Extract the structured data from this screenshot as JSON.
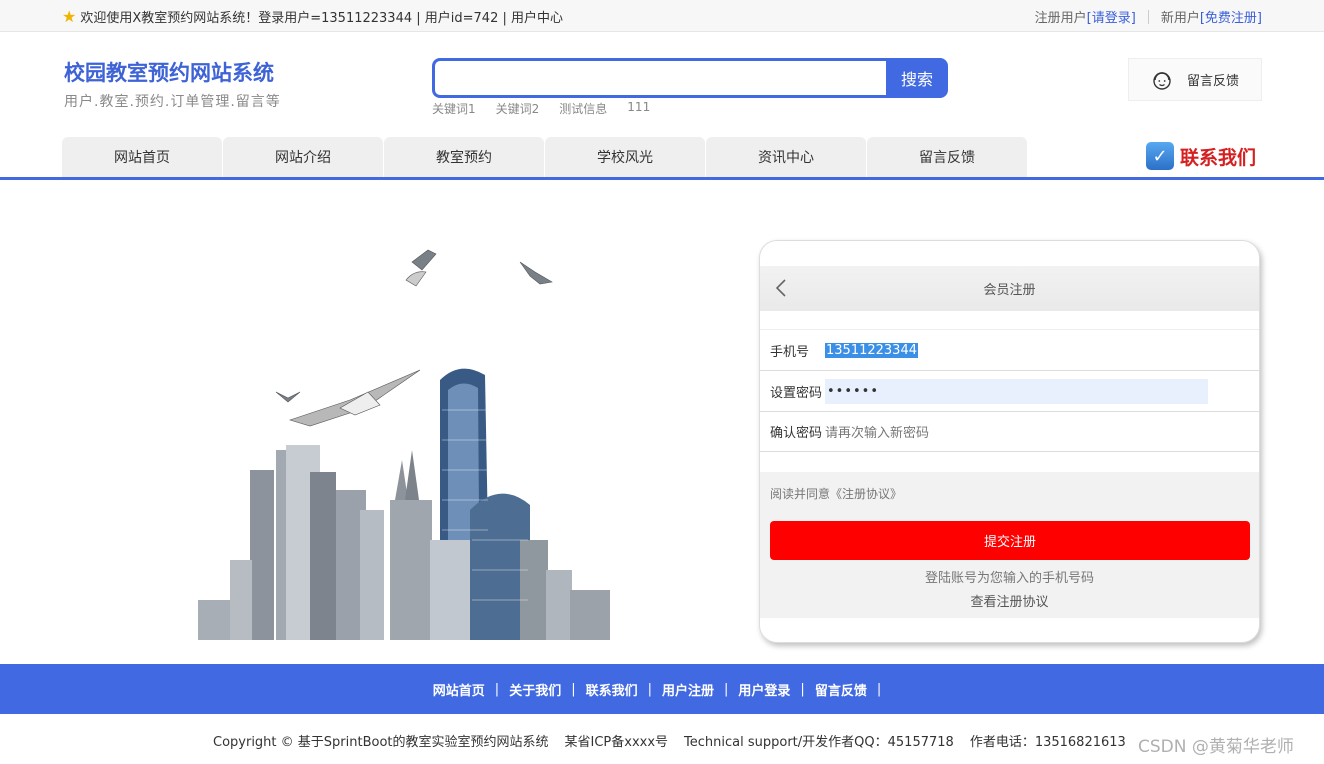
{
  "topbar": {
    "welcome": "欢迎使用X教室预约网站系统！登录用户=13511223344 | 用户id=742 | 用户中心",
    "registered_user": "注册用户",
    "login_link": "[请登录]",
    "new_user": "新用户",
    "register_link": "[免费注册]"
  },
  "brand": {
    "title": "校园教室预约网站系统",
    "subtitle": "用户.教室.预约.订单管理.留言等"
  },
  "search": {
    "button": "搜索",
    "keywords": [
      "关键词1",
      "关键词2",
      "测试信息",
      "111"
    ]
  },
  "feedback": {
    "label": "留言反馈"
  },
  "nav": {
    "items": [
      "网站首页",
      "网站介绍",
      "教室预约",
      "学校风光",
      "资讯中心",
      "留言反馈"
    ]
  },
  "contact": {
    "label": "联系我们"
  },
  "register_card": {
    "title": "会员注册",
    "phone_label": "手机号",
    "phone_value": "13511223344",
    "password_label": "设置密码",
    "password_value": "••••••",
    "confirm_label": "确认密码",
    "confirm_placeholder": "请再次输入新密码",
    "agree_text": "阅读并同意《注册协议》",
    "submit": "提交注册",
    "tip": "登陆账号为您输入的手机号码",
    "view_agreement": "查看注册协议"
  },
  "footer": {
    "links": [
      "网站首页",
      "关于我们",
      "联系我们",
      "用户注册",
      "用户登录",
      "留言反馈"
    ],
    "copyright": "Copyright © 基于SprintBoot的教室实验室预约网站系统",
    "icp": "某省ICP备xxxx号",
    "support": "Technical support/开发作者QQ：45157718",
    "phone": "作者电话：13516821613"
  },
  "watermark": "CSDN @黄菊华老师",
  "colors": {
    "primary": "#4169e1",
    "submit": "#ff0000",
    "contact": "#d42020"
  }
}
